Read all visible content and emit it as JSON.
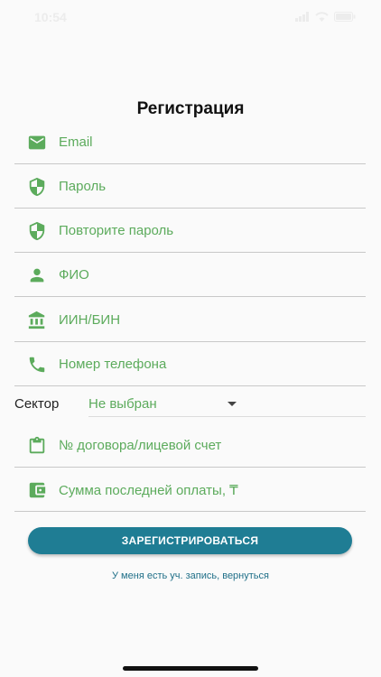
{
  "status_bar": {
    "time": "10:54"
  },
  "page": {
    "title": "Регистрация"
  },
  "fields": [
    {
      "label": "Email",
      "icon": "email-icon"
    },
    {
      "label": "Пароль",
      "icon": "shield-icon"
    },
    {
      "label": "Повторите пароль",
      "icon": "shield-icon"
    },
    {
      "label": "ФИО",
      "icon": "person-icon"
    },
    {
      "label": "ИИН/БИН",
      "icon": "bank-icon"
    },
    {
      "label": "Номер телефона",
      "icon": "phone-icon"
    }
  ],
  "sector": {
    "label": "Сектор",
    "value": "Не выбран"
  },
  "fields2": [
    {
      "label": "№ договора/лицевой счет",
      "icon": "clipboard-icon"
    },
    {
      "label": "Сумма последней оплаты, ₸",
      "icon": "wallet-icon"
    }
  ],
  "actions": {
    "register": "ЗАРЕГИСТРИРОВАТЬСЯ",
    "back": "У меня есть уч. запись, вернуться"
  },
  "colors": {
    "accent": "#5cab5c",
    "button": "#1f7d94",
    "link": "#1f6f88"
  }
}
